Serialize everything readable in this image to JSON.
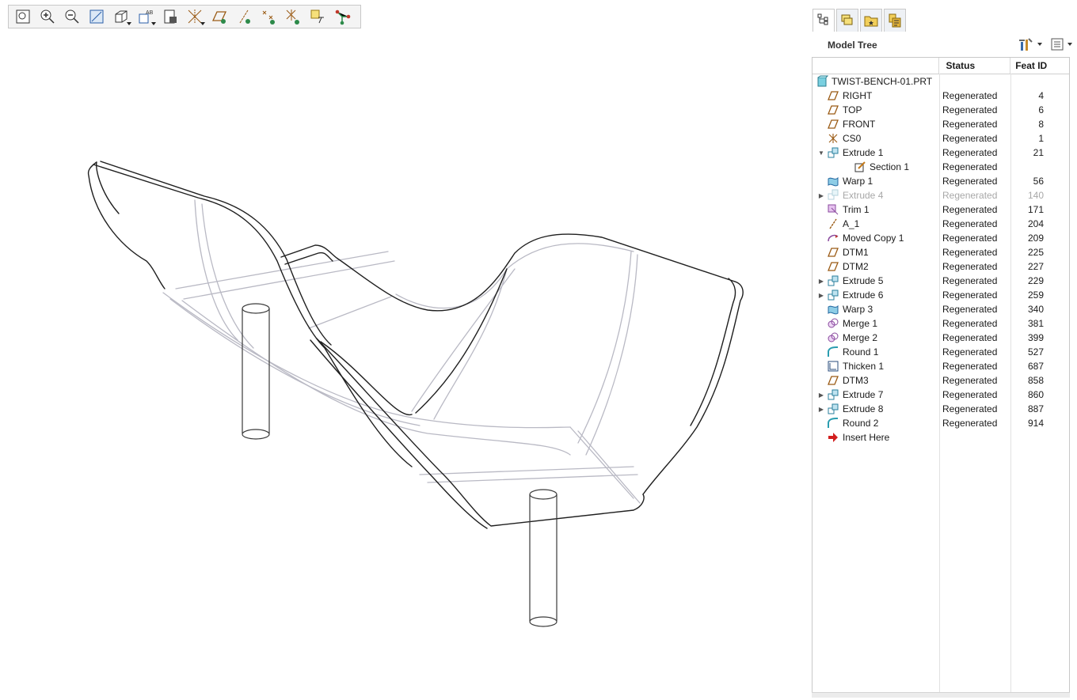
{
  "toolbar": {
    "buttons": [
      {
        "name": "refit-icon"
      },
      {
        "name": "zoom-in-icon"
      },
      {
        "name": "zoom-out-icon"
      },
      {
        "name": "repaint-icon"
      },
      {
        "name": "display-style-icon",
        "drop": true
      },
      {
        "name": "saved-views-icon",
        "drop": true
      },
      {
        "name": "view-manager-icon"
      },
      {
        "name": "spin-center-icon",
        "drop": true
      },
      {
        "name": "plane-display-icon"
      },
      {
        "name": "axis-display-icon"
      },
      {
        "name": "point-display-icon"
      },
      {
        "name": "csys-display-icon"
      },
      {
        "name": "annotation-display-icon"
      },
      {
        "name": "connect-icon"
      }
    ]
  },
  "panel": {
    "tabs": [
      "model-tree-tab-icon",
      "layers-tab-icon",
      "folder-browser-icon",
      "favorites-icon"
    ],
    "title": "Model Tree",
    "columns": {
      "status": "Status",
      "feat_id": "Feat ID"
    }
  },
  "tree": [
    {
      "label": "TWIST-BENCH-01.PRT",
      "status": "",
      "fid": "",
      "icon": "part",
      "indent": 0
    },
    {
      "label": "RIGHT",
      "status": "Regenerated",
      "fid": "4",
      "icon": "datum-plane",
      "indent": 1
    },
    {
      "label": "TOP",
      "status": "Regenerated",
      "fid": "6",
      "icon": "datum-plane",
      "indent": 1
    },
    {
      "label": "FRONT",
      "status": "Regenerated",
      "fid": "8",
      "icon": "datum-plane",
      "indent": 1
    },
    {
      "label": "CS0",
      "status": "Regenerated",
      "fid": "1",
      "icon": "csys",
      "indent": 1
    },
    {
      "label": "Extrude 1",
      "status": "Regenerated",
      "fid": "21",
      "icon": "extrude",
      "indent": 1,
      "expand": "open"
    },
    {
      "label": "Section 1",
      "status": "Regenerated",
      "fid": "",
      "icon": "sketch",
      "indent": 2
    },
    {
      "label": "Warp 1",
      "status": "Regenerated",
      "fid": "56",
      "icon": "warp",
      "indent": 1
    },
    {
      "label": "Extrude 4",
      "status": "Regenerated",
      "fid": "140",
      "icon": "extrude",
      "indent": 1,
      "expand": "closed",
      "suppressed": true
    },
    {
      "label": "Trim 1",
      "status": "Regenerated",
      "fid": "171",
      "icon": "trim",
      "indent": 1
    },
    {
      "label": "A_1",
      "status": "Regenerated",
      "fid": "204",
      "icon": "axis",
      "indent": 1
    },
    {
      "label": "Moved Copy 1",
      "status": "Regenerated",
      "fid": "209",
      "icon": "moved-copy",
      "indent": 1
    },
    {
      "label": "DTM1",
      "status": "Regenerated",
      "fid": "225",
      "icon": "datum-plane",
      "indent": 1
    },
    {
      "label": "DTM2",
      "status": "Regenerated",
      "fid": "227",
      "icon": "datum-plane",
      "indent": 1
    },
    {
      "label": "Extrude 5",
      "status": "Regenerated",
      "fid": "229",
      "icon": "extrude",
      "indent": 1,
      "expand": "closed"
    },
    {
      "label": "Extrude 6",
      "status": "Regenerated",
      "fid": "259",
      "icon": "extrude",
      "indent": 1,
      "expand": "closed"
    },
    {
      "label": "Warp 3",
      "status": "Regenerated",
      "fid": "340",
      "icon": "warp",
      "indent": 1
    },
    {
      "label": "Merge 1",
      "status": "Regenerated",
      "fid": "381",
      "icon": "merge",
      "indent": 1
    },
    {
      "label": "Merge 2",
      "status": "Regenerated",
      "fid": "399",
      "icon": "merge",
      "indent": 1
    },
    {
      "label": "Round 1",
      "status": "Regenerated",
      "fid": "527",
      "icon": "round",
      "indent": 1
    },
    {
      "label": "Thicken 1",
      "status": "Regenerated",
      "fid": "687",
      "icon": "thicken",
      "indent": 1
    },
    {
      "label": "DTM3",
      "status": "Regenerated",
      "fid": "858",
      "icon": "datum-plane",
      "indent": 1
    },
    {
      "label": "Extrude 7",
      "status": "Regenerated",
      "fid": "860",
      "icon": "extrude",
      "indent": 1,
      "expand": "closed"
    },
    {
      "label": "Extrude 8",
      "status": "Regenerated",
      "fid": "887",
      "icon": "extrude",
      "indent": 1,
      "expand": "closed"
    },
    {
      "label": "Round 2",
      "status": "Regenerated",
      "fid": "914",
      "icon": "round",
      "indent": 1
    },
    {
      "label": "Insert Here",
      "status": "",
      "fid": "",
      "icon": "insert-arrow",
      "indent": 1
    }
  ]
}
